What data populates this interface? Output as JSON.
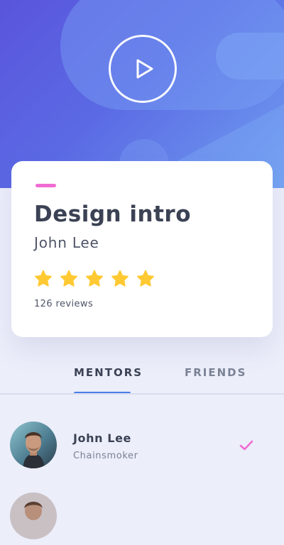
{
  "course": {
    "title": "Design intro",
    "author": "John Lee",
    "rating": 5,
    "rating_max": 5,
    "reviews": "126 reviews"
  },
  "tabs": {
    "mentors": "MENTORS",
    "friends": "FRIENDS",
    "active": "mentors"
  },
  "mentors": [
    {
      "name": "John Lee",
      "role": "Chainsmoker",
      "selected": true
    }
  ],
  "colors": {
    "accent_pink": "#f06cd2",
    "star_yellow": "#ffc933",
    "tab_indicator": "#4a7fe8",
    "hero_start": "#5a55dc",
    "hero_end": "#6f9ef0",
    "text_dark": "#3b4254"
  },
  "icons": {
    "hero": "play-icon",
    "rating": "star-icon",
    "selection": "checkmark-icon"
  }
}
